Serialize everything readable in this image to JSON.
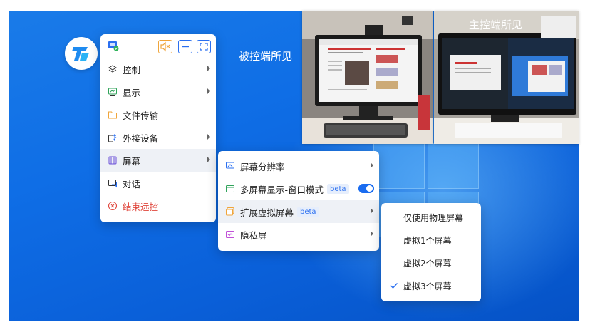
{
  "labels": {
    "controlled_view": "被控端所见",
    "main_view": "主控端所见"
  },
  "toolbar": {
    "icons": [
      "screen-status-icon",
      "mute-icon",
      "minimize-icon",
      "fullscreen-icon"
    ]
  },
  "main_menu": {
    "items": [
      {
        "label": "控制",
        "icon": "layers-icon",
        "has_submenu": true
      },
      {
        "label": "显示",
        "icon": "display-icon",
        "has_submenu": true
      },
      {
        "label": "文件传输",
        "icon": "folder-icon",
        "has_submenu": false
      },
      {
        "label": "外接设备",
        "icon": "usb-device-icon",
        "has_submenu": true
      },
      {
        "label": "屏幕",
        "icon": "screen-icon",
        "has_submenu": true,
        "active": true
      },
      {
        "label": "对话",
        "icon": "chat-icon",
        "has_submenu": false
      },
      {
        "label": "结束远控",
        "icon": "close-circle-icon",
        "has_submenu": false,
        "color": "#e0483e"
      }
    ]
  },
  "screen_menu": {
    "items": [
      {
        "label": "屏幕分辨率",
        "icon": "resolution-icon",
        "has_submenu": true
      },
      {
        "label": "多屏幕显示-窗口模式",
        "icon": "window-icon",
        "badge": "beta",
        "toggle_on": true
      },
      {
        "label": "扩展虚拟屏幕",
        "icon": "extend-screen-icon",
        "badge": "beta",
        "has_submenu": true,
        "active": true
      },
      {
        "label": "隐私屏",
        "icon": "privacy-screen-icon",
        "has_submenu": true
      }
    ]
  },
  "virtual_menu": {
    "items": [
      {
        "label": "仅使用物理屏幕",
        "checked": false
      },
      {
        "label": "虚拟1个屏幕",
        "checked": false
      },
      {
        "label": "虚拟2个屏幕",
        "checked": false
      },
      {
        "label": "虚拟3个屏幕",
        "checked": true
      }
    ]
  },
  "colors": {
    "accent": "#1a6cf0",
    "danger": "#e0483e",
    "desktop_blue": "#0f6ee6"
  }
}
